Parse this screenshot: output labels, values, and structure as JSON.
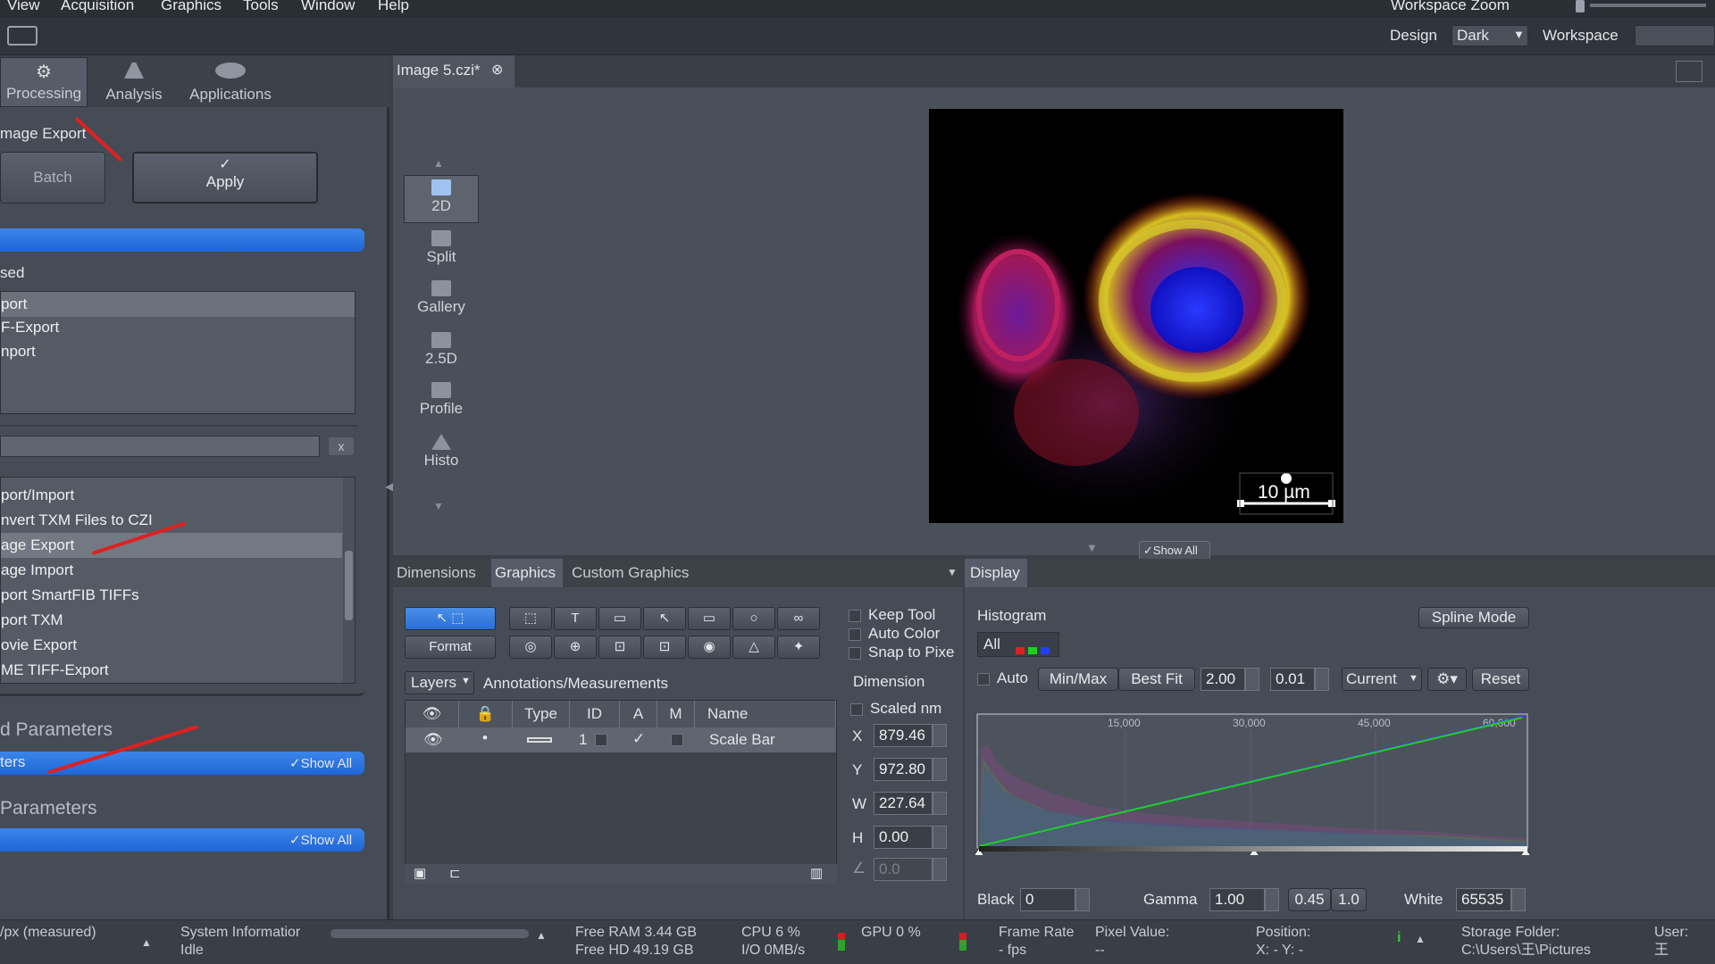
{
  "menu": [
    "View",
    "Acquisition",
    "Graphics",
    "Tools",
    "Window",
    "Help"
  ],
  "workspace_zoom_label": "Workspace Zoom",
  "toolbar": {
    "design_label": "Design",
    "design_value": "Dark",
    "workspace_label": "Workspace"
  },
  "left": {
    "tabs": [
      "Processing",
      "Analysis",
      "Applications"
    ],
    "method_title": "mage Export",
    "batch_label": "Batch",
    "apply_label": "Apply",
    "recent_title": "sed",
    "recent_items": [
      "port",
      "F-Export",
      "nport"
    ],
    "search_clear": "x",
    "method_items": [
      "port/Import",
      "nvert TXM Files to CZI",
      "age Export",
      "age Import",
      "port SmartFIB TIFFs",
      "port TXM",
      "ovie Export",
      "ME TIFF-Export"
    ],
    "params1_title": "d Parameters",
    "params1_bar": "ters",
    "show_all": "Show All",
    "params2_title": "Parameters"
  },
  "viewer": {
    "tab_title": "Image 5.czi*",
    "view_modes": [
      "2D",
      "Split",
      "Gallery",
      "2.5D",
      "Profile",
      "Histo"
    ],
    "scale_bar_label": "10 µm",
    "show_all": "Show All"
  },
  "graphics_panel": {
    "tabs": [
      "Dimensions",
      "Graphics",
      "Custom Graphics"
    ],
    "format_label": "Format",
    "options": [
      "Keep Tool",
      "Auto Color",
      "Snap to Pixe"
    ],
    "layers_label": "Layers",
    "annotations_label": "Annotations/Measurements",
    "columns": [
      "Type",
      "ID",
      "A",
      "M",
      "Name"
    ],
    "row": {
      "id": "1",
      "name": "Scale Bar"
    },
    "dimension_title": "Dimension",
    "scaled_label": "Scaled nm",
    "fields": [
      {
        "label": "X",
        "value": "879.46"
      },
      {
        "label": "Y",
        "value": "972.80"
      },
      {
        "label": "W",
        "value": "227.64"
      },
      {
        "label": "H",
        "value": "0.00"
      },
      {
        "label": "∠",
        "value": "0.0"
      }
    ]
  },
  "display_panel": {
    "tab": "Display",
    "histogram_label": "Histogram",
    "spline_mode": "Spline Mode",
    "all_label": "All",
    "auto_label": "Auto",
    "minmax": "Min/Max",
    "bestfit": "Best Fit",
    "val1": "2.00",
    "val2": "0.01",
    "current": "Current",
    "reset": "Reset",
    "axis_ticks": [
      "15,000",
      "30,000",
      "45,000",
      "60,000"
    ],
    "black_label": "Black",
    "black_value": "0",
    "gamma_label": "Gamma",
    "gamma_value": "1.00",
    "g1": "0.45",
    "g2": "1.0",
    "white_label": "White",
    "white_value": "65535"
  },
  "status": {
    "scale": "/px (measured)",
    "sys_info": "System Informatior",
    "sys_state": "Idle",
    "free_ram": "Free RAM 3.44 GB",
    "free_hd": "Free HD    49.19 GB",
    "cpu": "CPU 6 %",
    "io": "I/O   0MB/s",
    "gpu": "GPU 0 %",
    "frame_rate": "Frame Rate",
    "fps": "- fps",
    "pixel_value": "Pixel Value:",
    "pixel_dash": "--",
    "position": "Position:",
    "xy": "X: -    Y: -",
    "storage": "Storage Folder:",
    "storage_path": "C:\\Users\\王\\Pictures",
    "user": "User:",
    "user_name": "王"
  },
  "colors": {
    "accent_blue": "#2a74e0",
    "arrow_red": "#e02020"
  }
}
